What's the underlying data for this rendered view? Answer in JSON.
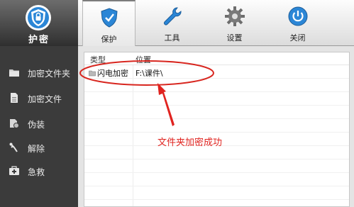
{
  "app": {
    "logo_label": "护密"
  },
  "toolbar": {
    "items": [
      {
        "label": "保护",
        "icon": "shield-icon"
      },
      {
        "label": "工具",
        "icon": "wrench-icon"
      },
      {
        "label": "设置",
        "icon": "gear-icon"
      },
      {
        "label": "关闭",
        "icon": "power-icon"
      }
    ],
    "active": "保护"
  },
  "sidebar": {
    "items": [
      {
        "label": "加密文件夹",
        "icon": "folder-icon"
      },
      {
        "label": "加密文件",
        "icon": "file-icon"
      },
      {
        "label": "伪装",
        "icon": "disguise-icon"
      },
      {
        "label": "解除",
        "icon": "unlock-icon"
      },
      {
        "label": "急救",
        "icon": "first-aid-icon"
      }
    ]
  },
  "list": {
    "columns": [
      "类型",
      "位置"
    ],
    "rows": [
      {
        "type": "闪电加密",
        "location": "F:\\课件\\"
      }
    ]
  },
  "annotation": {
    "text": "文件夹加密成功",
    "color": "#e0231f"
  }
}
